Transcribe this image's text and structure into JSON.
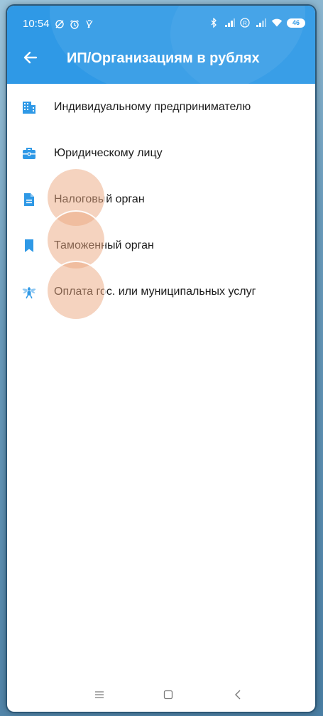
{
  "status_bar": {
    "time": "10:54",
    "battery_level": "46",
    "icons_left": [
      "alarm-off-icon",
      "alarm-clock-icon",
      "missed-call-icon"
    ],
    "icons_right": [
      "bluetooth-icon",
      "signal-icon",
      "roaming-icon",
      "signal-icon",
      "wifi-icon",
      "battery-icon"
    ]
  },
  "toolbar": {
    "title": "ИП/Организациям в рублях",
    "back_icon": "arrow-left-icon",
    "background_color": "#2f99e6"
  },
  "menu": {
    "items": [
      {
        "label": "Индивидуальному предпринимателю",
        "icon": "building-icon"
      },
      {
        "label": "Юридическому лицу",
        "icon": "briefcase-icon"
      },
      {
        "label": "Налоговый орган",
        "icon": "document-icon"
      },
      {
        "label": "Таможенный орган",
        "icon": "bookmark-icon"
      },
      {
        "label": "Оплата гос. или муниципальных услуг",
        "icon": "coat-of-arms-icon"
      }
    ],
    "icon_color": "#2f99e6"
  },
  "nav_bar": {
    "buttons": [
      "menu-icon",
      "home-icon",
      "back-icon"
    ]
  }
}
